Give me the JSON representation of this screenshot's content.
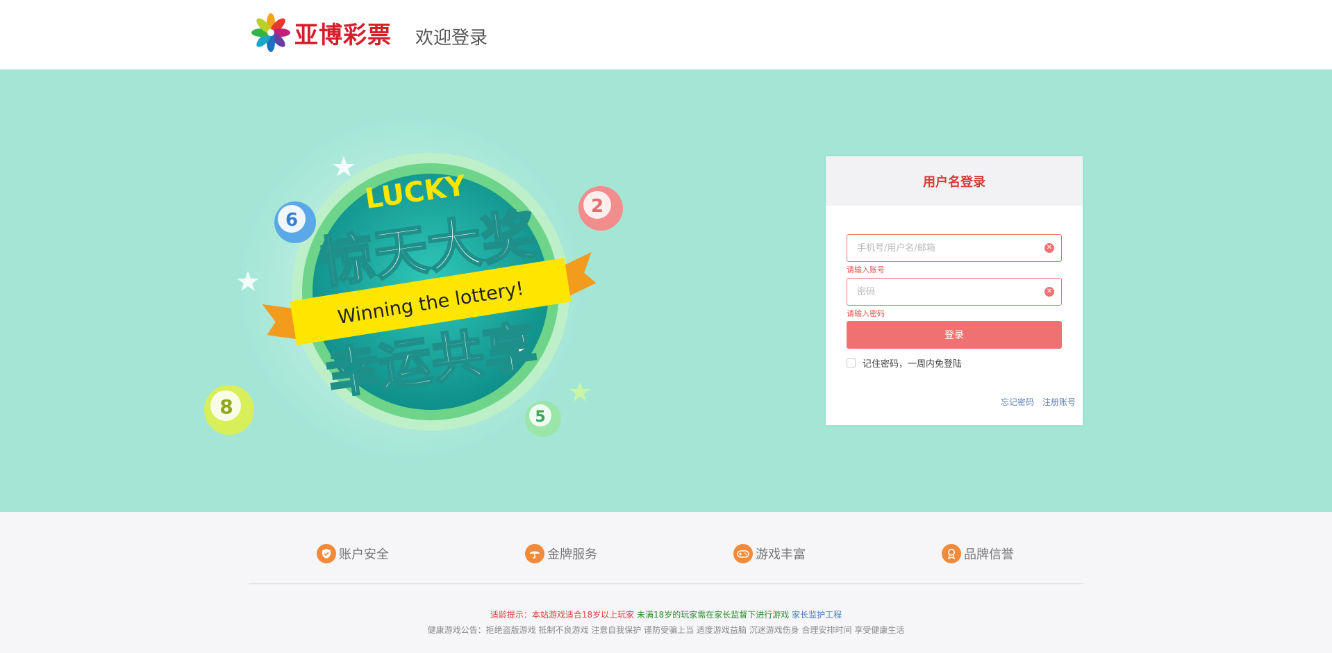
{
  "header": {
    "brand": "亚博彩票",
    "welcome": "欢迎登录"
  },
  "banner": {
    "lucky": "LUCKY",
    "title_top": "惊天大奖",
    "ribbon": "Winning the lottery!",
    "title_bottom": "幸运共享",
    "balls": [
      "6",
      "2",
      "8",
      "5"
    ]
  },
  "login": {
    "title": "用户名登录",
    "username_placeholder": "手机号/用户名/邮箱",
    "username_error": "请输入账号",
    "password_placeholder": "密码",
    "password_error": "请输入密码",
    "submit_label": "登录",
    "remember_label": "记住密码，一周内免登陆",
    "forgot_label": "忘记密码",
    "register_label": "注册账号"
  },
  "features": [
    {
      "label": "账户安全",
      "icon": "shield-icon"
    },
    {
      "label": "金牌服务",
      "icon": "umbrella-icon"
    },
    {
      "label": "游戏丰富",
      "icon": "gamepad-icon"
    },
    {
      "label": "品牌信誉",
      "icon": "award-icon"
    }
  ],
  "footer": {
    "age_tip": "适龄提示：本站游戏适合18岁以上玩家",
    "minor_tip": "未满18岁的玩家需在家长监督下进行游戏",
    "parent_link": "家长监护工程",
    "health_notice": "健康游戏公告：拒绝盗版游戏 抵制不良游戏 注意自我保护 谨防受骗上当 适度游戏益脑 沉迷游戏伤身 合理安排时间 享受健康生活"
  },
  "colors": {
    "hero_bg": "#a3e6d6",
    "brand_red": "#d61e2a",
    "button": "#f07171",
    "feature_icon": "#f08a3c"
  }
}
